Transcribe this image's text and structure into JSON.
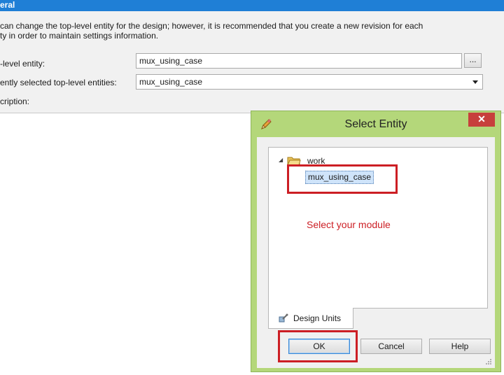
{
  "background_panel": {
    "header_title": "eral",
    "description_line1": " can change the top-level entity for the design; however, it is recommended that you create a new revision for each",
    "description_line2": "ty in order to maintain settings information.",
    "top_level_label": "-level entity:",
    "top_level_value": "mux_using_case",
    "browse_label": "...",
    "recent_label": "ently selected top-level entities:",
    "recent_value": "mux_using_case",
    "description_label": "cription:"
  },
  "dialog": {
    "title": "Select Entity",
    "close_label": "✕",
    "tree": {
      "root_label": "work",
      "child_label": "mux_using_case"
    },
    "annotation": "Select your module",
    "tab_label": "Design Units",
    "ok_label": "OK",
    "cancel_label": "Cancel",
    "help_label": "Help"
  },
  "colors": {
    "header_blue": "#1f7fd6",
    "dialog_frame_green": "#b4d77a",
    "close_red": "#c7403c",
    "annotation_red": "#cc1e24",
    "selection_blue": "#cfe4fa"
  },
  "icons": [
    "pencil-icon",
    "close-icon",
    "expander-icon",
    "folder-icon",
    "design-units-icon",
    "resize-grip-icon"
  ]
}
